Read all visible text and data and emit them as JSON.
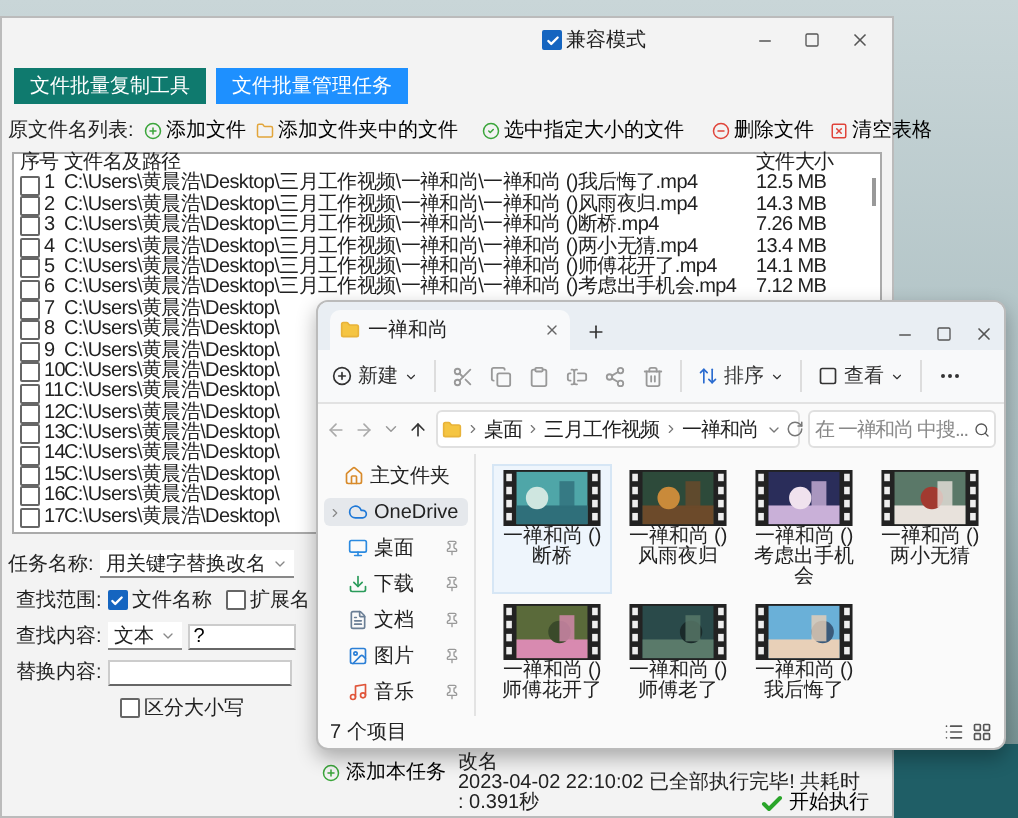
{
  "main_window": {
    "compat_mode": {
      "label": "兼容模式",
      "checked": true
    },
    "mode_buttons": [
      {
        "label": "文件批量复制工具",
        "selected": false
      },
      {
        "label": "文件批量管理任务",
        "selected": true
      }
    ],
    "list_label": "原文件名列表:",
    "actions": [
      {
        "kind": "add",
        "label": "添加文件"
      },
      {
        "kind": "folder",
        "label": "添加文件夹中的文件"
      },
      {
        "kind": "check",
        "label": "选中指定大小的文件"
      },
      {
        "kind": "remove",
        "label": "删除文件"
      },
      {
        "kind": "clear",
        "label": "清空表格"
      }
    ],
    "table": {
      "columns": [
        "序号",
        "文件名及路径",
        "文件大小"
      ],
      "rows": [
        {
          "index": "1",
          "checked": false,
          "path": "C:\\Users\\黄晨浩\\Desktop\\三月工作视频\\一禅和尚\\一禅和尚 ()我后悔了.mp4",
          "size": "12.5 MB"
        },
        {
          "index": "2",
          "checked": false,
          "path": "C:\\Users\\黄晨浩\\Desktop\\三月工作视频\\一禅和尚\\一禅和尚 ()风雨夜归.mp4",
          "size": "14.3 MB"
        },
        {
          "index": "3",
          "checked": false,
          "path": "C:\\Users\\黄晨浩\\Desktop\\三月工作视频\\一禅和尚\\一禅和尚 ()断桥.mp4",
          "size": "7.26 MB"
        },
        {
          "index": "4",
          "checked": false,
          "path": "C:\\Users\\黄晨浩\\Desktop\\三月工作视频\\一禅和尚\\一禅和尚 ()两小无猜.mp4",
          "size": "13.4 MB"
        },
        {
          "index": "5",
          "checked": false,
          "path": "C:\\Users\\黄晨浩\\Desktop\\三月工作视频\\一禅和尚\\一禅和尚 ()师傅花开了.mp4",
          "size": "14.1 MB"
        },
        {
          "index": "6",
          "checked": false,
          "path": "C:\\Users\\黄晨浩\\Desktop\\三月工作视频\\一禅和尚\\一禅和尚 ()考虑出手机会.mp4",
          "size": "7.12 MB"
        },
        {
          "index": "7",
          "checked": false,
          "path": "C:\\Users\\黄晨浩\\Desktop\\"
        },
        {
          "index": "8",
          "checked": false,
          "path": "C:\\Users\\黄晨浩\\Desktop\\"
        },
        {
          "index": "9",
          "checked": false,
          "path": "C:\\Users\\黄晨浩\\Desktop\\"
        },
        {
          "index": "10",
          "checked": false,
          "path": "C:\\Users\\黄晨浩\\Desktop\\"
        },
        {
          "index": "11",
          "checked": false,
          "path": "C:\\Users\\黄晨浩\\Desktop\\"
        },
        {
          "index": "12",
          "checked": false,
          "path": "C:\\Users\\黄晨浩\\Desktop\\"
        },
        {
          "index": "13",
          "checked": false,
          "path": "C:\\Users\\黄晨浩\\Desktop\\"
        },
        {
          "index": "14",
          "checked": false,
          "path": "C:\\Users\\黄晨浩\\Desktop\\"
        },
        {
          "index": "15",
          "checked": false,
          "path": "C:\\Users\\黄晨浩\\Desktop\\"
        },
        {
          "index": "16",
          "checked": false,
          "path": "C:\\Users\\黄晨浩\\Desktop\\"
        },
        {
          "index": "17",
          "checked": false,
          "path": "C:\\Users\\黄晨浩\\Desktop\\"
        }
      ]
    },
    "form": {
      "task_label": "任务名称:",
      "task_value": "用关键字替换改名",
      "range_label": "查找范围:",
      "range_options": [
        {
          "label": "文件名称",
          "checked": true
        },
        {
          "label": "扩展名",
          "checked": false
        }
      ],
      "find_label": "查找内容:",
      "find_type": "文本",
      "find_value": "?",
      "replace_label": "替换内容:",
      "case_option": {
        "label": "区分大小写",
        "checked": false
      }
    },
    "add_task": "添加本任务",
    "status_lines": [
      "改名",
      "2023-04-02 22:10:02 已全部执行完毕! 共耗时",
      ": 0.391秒"
    ],
    "run_button": "开始执行"
  },
  "explorer": {
    "tab": "一禅和尚",
    "toolbar": {
      "new": "新建",
      "sort": "排序",
      "view": "查看"
    },
    "breadcrumb": [
      "桌面",
      "三月工作视频",
      "一禅和尚"
    ],
    "search": {
      "placeholder": "在 一禅和尚 中搜..."
    },
    "sidebar": [
      {
        "kind": "home",
        "label": "主文件夹",
        "selected": false,
        "pinned": false
      },
      {
        "kind": "cloud",
        "label": "OneDrive",
        "selected": true,
        "pinned": false
      },
      {
        "kind": "desktop",
        "label": "桌面",
        "selected": false,
        "pinned": true
      },
      {
        "kind": "download",
        "label": "下载",
        "selected": false,
        "pinned": true
      },
      {
        "kind": "docs",
        "label": "文档",
        "selected": false,
        "pinned": true
      },
      {
        "kind": "pictures",
        "label": "图片",
        "selected": false,
        "pinned": true
      },
      {
        "kind": "music",
        "label": "音乐",
        "selected": false,
        "pinned": true
      }
    ],
    "files": [
      {
        "label": "一禅和尚 ()断桥",
        "selected": true
      },
      {
        "label": "一禅和尚 ()风雨夜归",
        "selected": false
      },
      {
        "label": "一禅和尚 ()考虑出手机会",
        "selected": false
      },
      {
        "label": "一禅和尚 ()两小无猜",
        "selected": false
      },
      {
        "label": "一禅和尚 ()师傅花开了",
        "selected": false
      },
      {
        "label": "一禅和尚 ()师傅老了",
        "selected": false
      },
      {
        "label": "一禅和尚 ()我后悔了",
        "selected": false
      }
    ],
    "status": "7 个项目"
  }
}
